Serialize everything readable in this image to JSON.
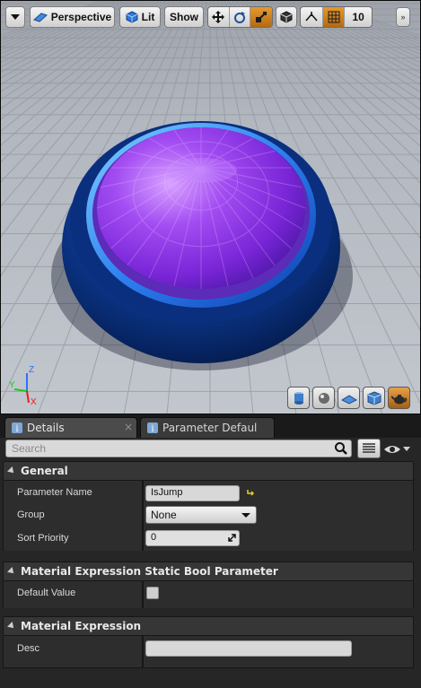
{
  "toolbar": {
    "dropdown_icon": "chevron-down-icon",
    "perspective_label": "Perspective",
    "lit_label": "Lit",
    "show_label": "Show",
    "camera_speed": "10",
    "accent_color": "#d88a22"
  },
  "viewport": {
    "axis_labels": {
      "x": "X",
      "y": "Y",
      "z": "Z"
    },
    "preview_mesh_icons": [
      "cylinder-icon",
      "sphere-icon",
      "plane-icon",
      "cube-icon",
      "teapot-icon"
    ]
  },
  "panel": {
    "tabs": [
      {
        "label": "Details",
        "icon": "info-icon",
        "close": "×"
      },
      {
        "label": "Parameter Defaults",
        "icon": "info-icon"
      }
    ],
    "search": {
      "placeholder": "Search"
    },
    "categories": {
      "general": {
        "title": "General",
        "properties": [
          {
            "label": "Parameter Name",
            "value": "IsJump"
          },
          {
            "label": "Group",
            "value": "None"
          },
          {
            "label": "Sort Priority",
            "value": "0"
          }
        ]
      },
      "static_bool": {
        "title": "Material Expression Static Bool Parameter",
        "properties": [
          {
            "label": "Default Value",
            "checked": false
          }
        ]
      },
      "expression": {
        "title": "Material Expression",
        "properties": [
          {
            "label": "Desc",
            "value": ""
          }
        ]
      }
    }
  }
}
